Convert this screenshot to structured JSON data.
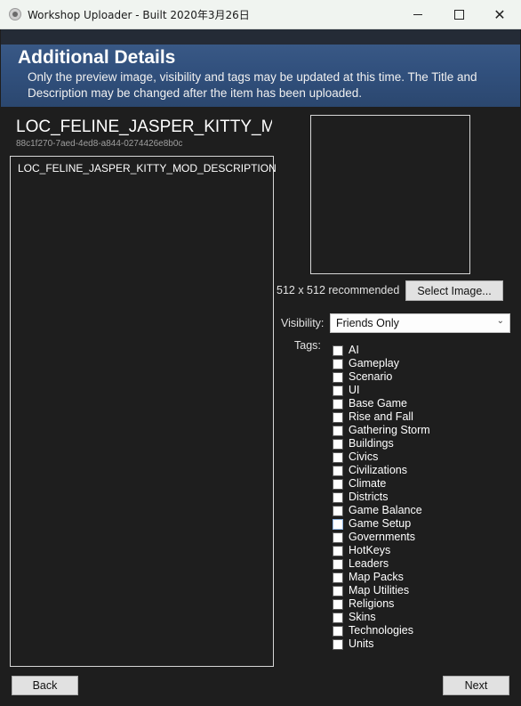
{
  "window": {
    "title": "Workshop Uploader - Built 2020年3月26日",
    "minimize_glyph": "",
    "maximize_glyph": "",
    "close_glyph": "✕"
  },
  "header": {
    "title": "Additional Details",
    "description": "Only the preview image, visibility and tags may be updated at this time.  The Title and Description may be changed after the item has been uploaded."
  },
  "item": {
    "title": "LOC_FELINE_JASPER_KITTY_MOD_",
    "id": "88c1f270-7aed-4ed8-a844-0274426e8b0c",
    "description": "LOC_FELINE_JASPER_KITTY_MOD_DESCRIPTION"
  },
  "preview": {
    "recommendation": "512 x 512 recommended",
    "select_button": "Select Image..."
  },
  "visibility": {
    "label": "Visibility:",
    "selected": "Friends Only",
    "chevron": "⌄"
  },
  "tags": {
    "label": "Tags:",
    "items": [
      {
        "label": "AI",
        "checked": false
      },
      {
        "label": "Gameplay",
        "checked": false
      },
      {
        "label": "Scenario",
        "checked": false
      },
      {
        "label": "UI",
        "checked": false
      },
      {
        "label": "Base Game",
        "checked": false
      },
      {
        "label": "Rise and Fall",
        "checked": false
      },
      {
        "label": "Gathering Storm",
        "checked": false
      },
      {
        "label": "Buildings",
        "checked": false
      },
      {
        "label": "Civics",
        "checked": false
      },
      {
        "label": "Civilizations",
        "checked": false
      },
      {
        "label": "Climate",
        "checked": false
      },
      {
        "label": "Districts",
        "checked": false
      },
      {
        "label": "Game Balance",
        "checked": false
      },
      {
        "label": "Game Setup",
        "checked": false,
        "focused": true
      },
      {
        "label": "Governments",
        "checked": false
      },
      {
        "label": "HotKeys",
        "checked": false
      },
      {
        "label": "Leaders",
        "checked": false
      },
      {
        "label": "Map Packs",
        "checked": false
      },
      {
        "label": "Map Utilities",
        "checked": false
      },
      {
        "label": "Religions",
        "checked": false
      },
      {
        "label": "Skins",
        "checked": false
      },
      {
        "label": "Technologies",
        "checked": false
      },
      {
        "label": "Units",
        "checked": false
      }
    ]
  },
  "footer": {
    "back_label": "Back",
    "next_label": "Next"
  }
}
